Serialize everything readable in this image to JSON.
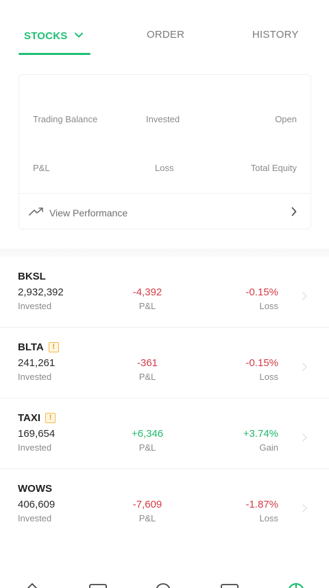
{
  "tabs": {
    "stocks": "STOCKS",
    "order": "ORDER",
    "history": "HISTORY"
  },
  "summary": {
    "trading_balance_label": "Trading Balance",
    "invested_label": "Invested",
    "open_label": "Open",
    "pl_label": "P&L",
    "loss_label": "Loss",
    "total_equity_label": "Total Equity",
    "view_performance": "View Performance"
  },
  "stocks": [
    {
      "ticker": "BKSL",
      "warning": false,
      "invested": "2,932,392",
      "invested_label": "Invested",
      "pl": "-4,392",
      "pl_label": "P&L",
      "pct": "-0.15%",
      "pct_label": "Loss",
      "trend": "down"
    },
    {
      "ticker": "BLTA",
      "warning": true,
      "invested": "241,261",
      "invested_label": "Invested",
      "pl": "-361",
      "pl_label": "P&L",
      "pct": "-0.15%",
      "pct_label": "Loss",
      "trend": "down"
    },
    {
      "ticker": "TAXI",
      "warning": true,
      "invested": "169,654",
      "invested_label": "Invested",
      "pl": "+6,346",
      "pl_label": "P&L",
      "pct": "+3.74%",
      "pct_label": "Gain",
      "trend": "up"
    },
    {
      "ticker": "WOWS",
      "warning": false,
      "invested": "406,609",
      "invested_label": "Invested",
      "pl": "-7,609",
      "pl_label": "P&L",
      "pct": "-1.87%",
      "pct_label": "Loss",
      "trend": "down"
    }
  ],
  "colors": {
    "accent": "#1fbf73",
    "loss": "#d23a47",
    "gain": "#1fb86b",
    "warning": "#f2b84b"
  },
  "icons": {
    "tab_dropdown": "chevron-down-icon",
    "performance": "trending-up-icon",
    "row_arrow": "chevron-right-icon",
    "warning": "warning-badge-icon"
  }
}
